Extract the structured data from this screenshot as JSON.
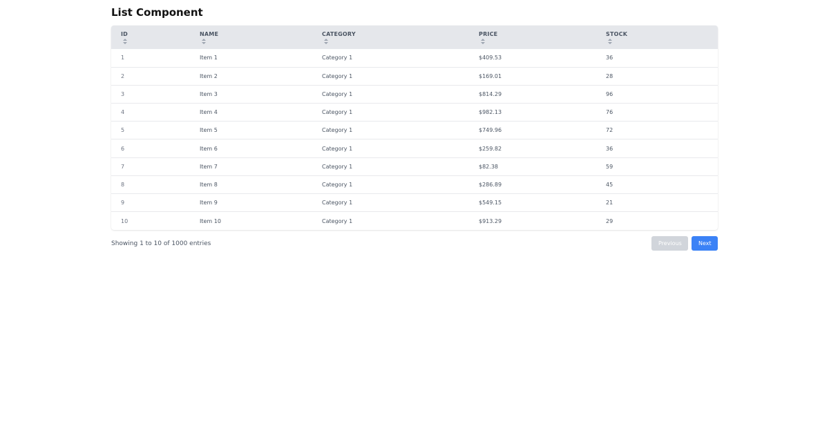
{
  "page": {
    "title": "List Component"
  },
  "table": {
    "columns": [
      {
        "label": "ID",
        "icon": "sort-icon"
      },
      {
        "label": "NAME",
        "icon": "sort-icon"
      },
      {
        "label": "CATEGORY",
        "icon": "sort-icon"
      },
      {
        "label": "PRICE",
        "icon": "sort-icon"
      },
      {
        "label": "STOCK",
        "icon": "sort-icon"
      }
    ],
    "rows": [
      {
        "id": "1",
        "name": "Item 1",
        "category": "Category 1",
        "price": "$409.53",
        "stock": "36"
      },
      {
        "id": "2",
        "name": "Item 2",
        "category": "Category 1",
        "price": "$169.01",
        "stock": "28"
      },
      {
        "id": "3",
        "name": "Item 3",
        "category": "Category 1",
        "price": "$814.29",
        "stock": "96"
      },
      {
        "id": "4",
        "name": "Item 4",
        "category": "Category 1",
        "price": "$982.13",
        "stock": "76"
      },
      {
        "id": "5",
        "name": "Item 5",
        "category": "Category 1",
        "price": "$749.96",
        "stock": "72"
      },
      {
        "id": "6",
        "name": "Item 6",
        "category": "Category 1",
        "price": "$259.82",
        "stock": "36"
      },
      {
        "id": "7",
        "name": "Item 7",
        "category": "Category 1",
        "price": "$82.38",
        "stock": "59"
      },
      {
        "id": "8",
        "name": "Item 8",
        "category": "Category 1",
        "price": "$286.89",
        "stock": "45"
      },
      {
        "id": "9",
        "name": "Item 9",
        "category": "Category 1",
        "price": "$549.15",
        "stock": "21"
      },
      {
        "id": "10",
        "name": "Item 10",
        "category": "Category 1",
        "price": "$913.29",
        "stock": "29"
      }
    ]
  },
  "footer": {
    "entries_text": "Showing 1 to 10 of 1000 entries",
    "previous_label": "Previous",
    "next_label": "Next"
  },
  "colors": {
    "header_bg": "#e5e7eb",
    "primary": "#3b82f6",
    "disabled": "#d1d5db"
  }
}
